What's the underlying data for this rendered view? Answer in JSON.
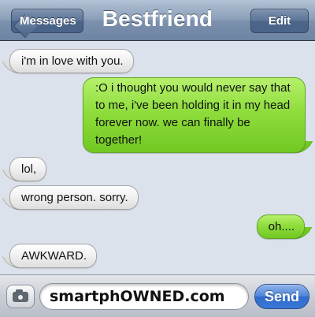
{
  "navbar": {
    "title": "Bestfriend",
    "back_label": "Messages",
    "edit_label": "Edit"
  },
  "messages": [
    {
      "side": "received",
      "text": "i'm in love with you."
    },
    {
      "side": "sent",
      "text": ":O i thought you would never say that to me, i've been holding it in my head forever now. we can finally be together!"
    },
    {
      "side": "received",
      "text": "lol,"
    },
    {
      "side": "received",
      "text": "wrong person. sorry."
    },
    {
      "side": "sent",
      "text": "oh...."
    },
    {
      "side": "received",
      "text": "AWKWARD."
    }
  ],
  "composer": {
    "value": "smartphOWNED.com",
    "send_label": "Send",
    "camera_icon": "camera-icon"
  },
  "colors": {
    "sent_bubble": "#8fdd3c",
    "received_bubble": "#f1f1f1",
    "navbar": "#7b91ad",
    "send_button": "#3a77d6",
    "background": "#dbe2ec"
  }
}
